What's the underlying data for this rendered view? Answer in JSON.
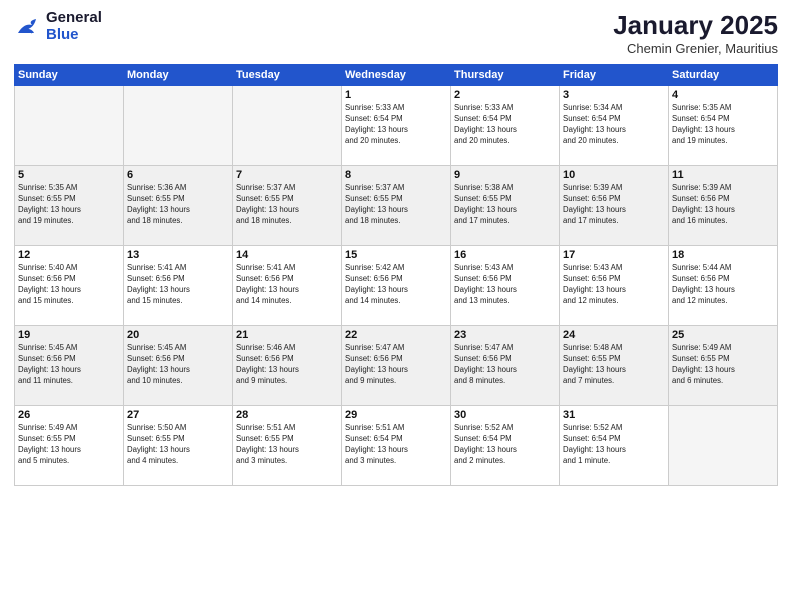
{
  "logo": {
    "line1": "General",
    "line2": "Blue"
  },
  "title": "January 2025",
  "subtitle": "Chemin Grenier, Mauritius",
  "days_of_week": [
    "Sunday",
    "Monday",
    "Tuesday",
    "Wednesday",
    "Thursday",
    "Friday",
    "Saturday"
  ],
  "weeks": [
    [
      {
        "num": "",
        "info": ""
      },
      {
        "num": "",
        "info": ""
      },
      {
        "num": "",
        "info": ""
      },
      {
        "num": "1",
        "info": "Sunrise: 5:33 AM\nSunset: 6:54 PM\nDaylight: 13 hours\nand 20 minutes."
      },
      {
        "num": "2",
        "info": "Sunrise: 5:33 AM\nSunset: 6:54 PM\nDaylight: 13 hours\nand 20 minutes."
      },
      {
        "num": "3",
        "info": "Sunrise: 5:34 AM\nSunset: 6:54 PM\nDaylight: 13 hours\nand 20 minutes."
      },
      {
        "num": "4",
        "info": "Sunrise: 5:35 AM\nSunset: 6:54 PM\nDaylight: 13 hours\nand 19 minutes."
      }
    ],
    [
      {
        "num": "5",
        "info": "Sunrise: 5:35 AM\nSunset: 6:55 PM\nDaylight: 13 hours\nand 19 minutes."
      },
      {
        "num": "6",
        "info": "Sunrise: 5:36 AM\nSunset: 6:55 PM\nDaylight: 13 hours\nand 18 minutes."
      },
      {
        "num": "7",
        "info": "Sunrise: 5:37 AM\nSunset: 6:55 PM\nDaylight: 13 hours\nand 18 minutes."
      },
      {
        "num": "8",
        "info": "Sunrise: 5:37 AM\nSunset: 6:55 PM\nDaylight: 13 hours\nand 18 minutes."
      },
      {
        "num": "9",
        "info": "Sunrise: 5:38 AM\nSunset: 6:55 PM\nDaylight: 13 hours\nand 17 minutes."
      },
      {
        "num": "10",
        "info": "Sunrise: 5:39 AM\nSunset: 6:56 PM\nDaylight: 13 hours\nand 17 minutes."
      },
      {
        "num": "11",
        "info": "Sunrise: 5:39 AM\nSunset: 6:56 PM\nDaylight: 13 hours\nand 16 minutes."
      }
    ],
    [
      {
        "num": "12",
        "info": "Sunrise: 5:40 AM\nSunset: 6:56 PM\nDaylight: 13 hours\nand 15 minutes."
      },
      {
        "num": "13",
        "info": "Sunrise: 5:41 AM\nSunset: 6:56 PM\nDaylight: 13 hours\nand 15 minutes."
      },
      {
        "num": "14",
        "info": "Sunrise: 5:41 AM\nSunset: 6:56 PM\nDaylight: 13 hours\nand 14 minutes."
      },
      {
        "num": "15",
        "info": "Sunrise: 5:42 AM\nSunset: 6:56 PM\nDaylight: 13 hours\nand 14 minutes."
      },
      {
        "num": "16",
        "info": "Sunrise: 5:43 AM\nSunset: 6:56 PM\nDaylight: 13 hours\nand 13 minutes."
      },
      {
        "num": "17",
        "info": "Sunrise: 5:43 AM\nSunset: 6:56 PM\nDaylight: 13 hours\nand 12 minutes."
      },
      {
        "num": "18",
        "info": "Sunrise: 5:44 AM\nSunset: 6:56 PM\nDaylight: 13 hours\nand 12 minutes."
      }
    ],
    [
      {
        "num": "19",
        "info": "Sunrise: 5:45 AM\nSunset: 6:56 PM\nDaylight: 13 hours\nand 11 minutes."
      },
      {
        "num": "20",
        "info": "Sunrise: 5:45 AM\nSunset: 6:56 PM\nDaylight: 13 hours\nand 10 minutes."
      },
      {
        "num": "21",
        "info": "Sunrise: 5:46 AM\nSunset: 6:56 PM\nDaylight: 13 hours\nand 9 minutes."
      },
      {
        "num": "22",
        "info": "Sunrise: 5:47 AM\nSunset: 6:56 PM\nDaylight: 13 hours\nand 9 minutes."
      },
      {
        "num": "23",
        "info": "Sunrise: 5:47 AM\nSunset: 6:56 PM\nDaylight: 13 hours\nand 8 minutes."
      },
      {
        "num": "24",
        "info": "Sunrise: 5:48 AM\nSunset: 6:55 PM\nDaylight: 13 hours\nand 7 minutes."
      },
      {
        "num": "25",
        "info": "Sunrise: 5:49 AM\nSunset: 6:55 PM\nDaylight: 13 hours\nand 6 minutes."
      }
    ],
    [
      {
        "num": "26",
        "info": "Sunrise: 5:49 AM\nSunset: 6:55 PM\nDaylight: 13 hours\nand 5 minutes."
      },
      {
        "num": "27",
        "info": "Sunrise: 5:50 AM\nSunset: 6:55 PM\nDaylight: 13 hours\nand 4 minutes."
      },
      {
        "num": "28",
        "info": "Sunrise: 5:51 AM\nSunset: 6:55 PM\nDaylight: 13 hours\nand 3 minutes."
      },
      {
        "num": "29",
        "info": "Sunrise: 5:51 AM\nSunset: 6:54 PM\nDaylight: 13 hours\nand 3 minutes."
      },
      {
        "num": "30",
        "info": "Sunrise: 5:52 AM\nSunset: 6:54 PM\nDaylight: 13 hours\nand 2 minutes."
      },
      {
        "num": "31",
        "info": "Sunrise: 5:52 AM\nSunset: 6:54 PM\nDaylight: 13 hours\nand 1 minute."
      },
      {
        "num": "",
        "info": ""
      }
    ]
  ]
}
